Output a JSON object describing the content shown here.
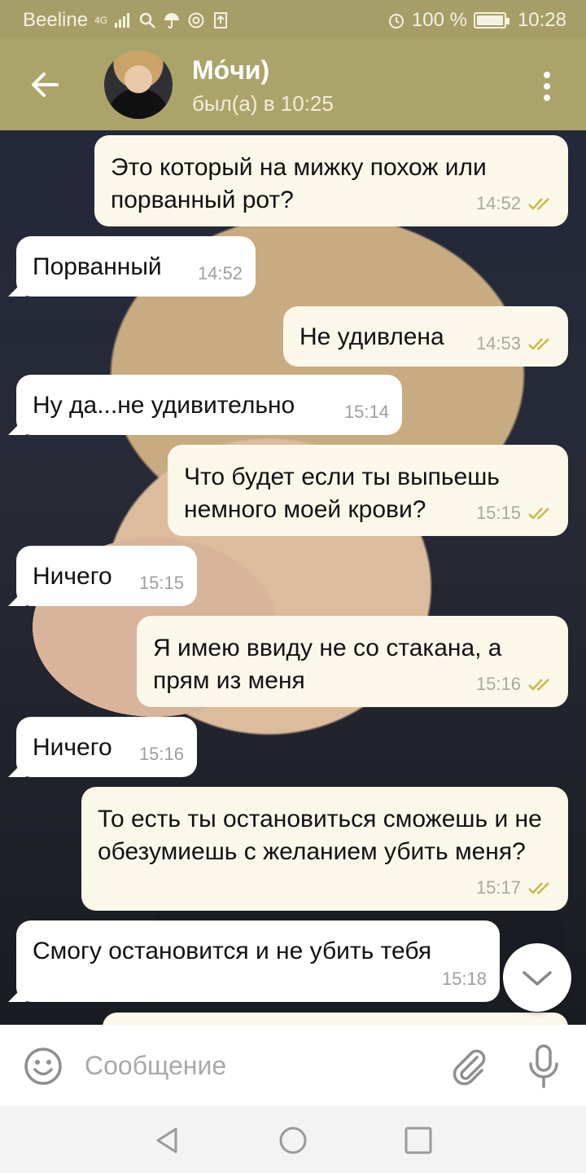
{
  "status_bar": {
    "carrier": "Beeline",
    "network": "4G",
    "battery": "100 %",
    "battery_level": 1.0,
    "time": "10:28"
  },
  "header": {
    "name": "Мо́чи)",
    "last_seen": "был(а) в 10:25"
  },
  "messages": [
    {
      "dir": "out",
      "text": "Это который на мижку похож или порванный рот?",
      "time": "14:52",
      "read": true
    },
    {
      "dir": "in",
      "text": "Порванный",
      "time": "14:52"
    },
    {
      "dir": "out",
      "text": "Не удивлена",
      "time": "14:53",
      "read": true
    },
    {
      "dir": "in",
      "text": "Ну да...не удивительно",
      "time": "15:14"
    },
    {
      "dir": "out",
      "text": "Что будет если ты выпьешь немного моей крови?",
      "time": "15:15",
      "read": true
    },
    {
      "dir": "in",
      "text": "Ничего",
      "time": "15:15"
    },
    {
      "dir": "out",
      "text": "Я имею ввиду не со стакана, а прям из меня",
      "time": "15:16",
      "read": true
    },
    {
      "dir": "in",
      "text": "Ничего",
      "time": "15:16"
    },
    {
      "dir": "out",
      "text": "То есть ты остановиться сможешь и не обезумиешь с желанием убить меня?",
      "time": "15:17",
      "read": true
    },
    {
      "dir": "in",
      "text": "Смогу остановится и не убить тебя",
      "time": "15:18"
    }
  ],
  "composer": {
    "placeholder": "Сообщение"
  },
  "colors": {
    "header": "#aaa46b",
    "status_bar": "#a59f67",
    "outgoing_bubble": "#fbf8ea",
    "incoming_bubble": "#ffffff",
    "read_check": "#c8b84a"
  },
  "icons": [
    "back-arrow-icon",
    "more-vertical-icon",
    "double-check-icon",
    "chevron-down-icon",
    "emoji-icon",
    "attach-icon",
    "mic-icon",
    "nav-back-icon",
    "nav-home-icon",
    "nav-recents-icon"
  ]
}
